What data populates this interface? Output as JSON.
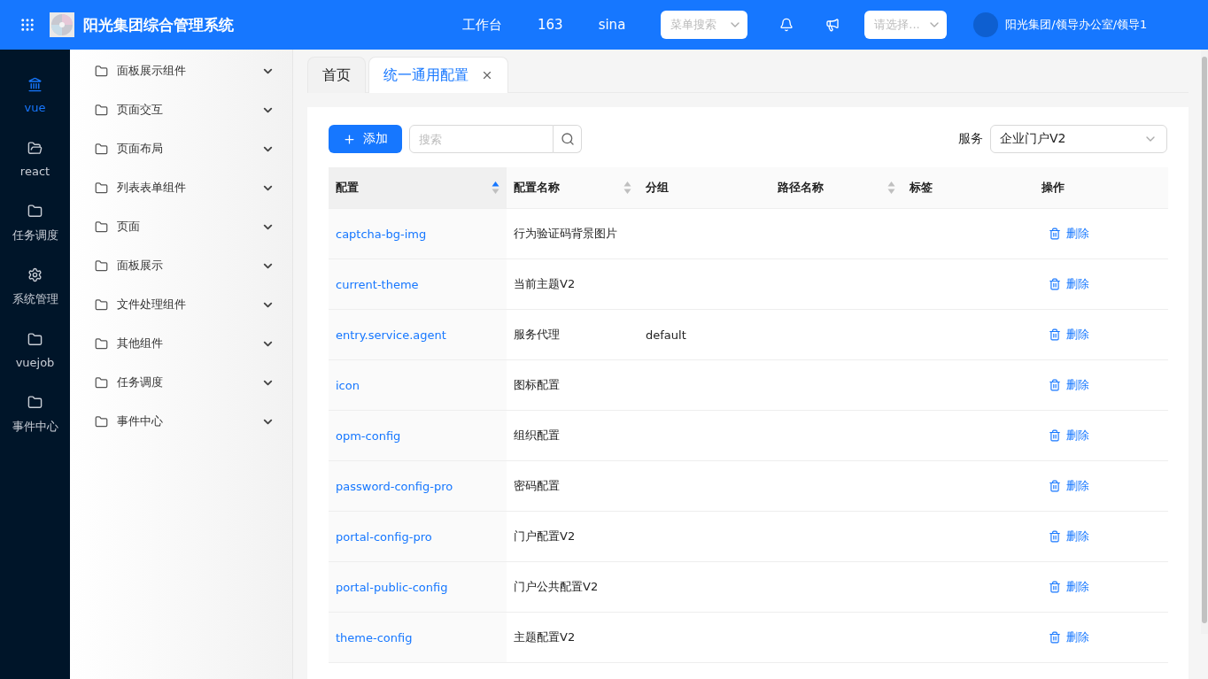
{
  "header": {
    "title": "阳光集团综合管理系统",
    "nav": [
      "工作台",
      "163",
      "sina"
    ],
    "menu_search": {
      "placeholder": "菜单搜索"
    },
    "org_select": {
      "placeholder": "请选择..."
    },
    "user": "阳光集团/领导办公室/领导1"
  },
  "rail": [
    {
      "label": "vue",
      "selected": true
    },
    {
      "label": "react",
      "selected": false
    },
    {
      "label": "任务调度",
      "selected": false
    },
    {
      "label": "系统管理",
      "selected": false
    },
    {
      "label": "vuejob",
      "selected": false
    },
    {
      "label": "事件中心",
      "selected": false
    }
  ],
  "submenu": [
    {
      "label": "面板展示组件",
      "expanded": false
    },
    {
      "label": "页面交互",
      "expanded": false
    },
    {
      "label": "页面布局",
      "expanded": false
    },
    {
      "label": "列表表单组件",
      "expanded": false
    },
    {
      "label": "页面",
      "expanded": false
    },
    {
      "label": "面板展示",
      "expanded": false
    },
    {
      "label": "文件处理组件",
      "expanded": false
    },
    {
      "label": "其他组件",
      "expanded": false
    },
    {
      "label": "任务调度",
      "expanded": false
    },
    {
      "label": "事件中心",
      "expanded": false
    }
  ],
  "tabs": [
    {
      "label": "首页",
      "selected": false,
      "closable": false
    },
    {
      "label": "统一通用配置",
      "selected": true,
      "closable": true
    }
  ],
  "toolbar": {
    "add": "添加",
    "search": {
      "placeholder": "搜索"
    },
    "service_label": "服务",
    "service_value": "企业门户V2"
  },
  "table": {
    "columns": [
      {
        "label": "配置",
        "sortable": true,
        "sorted": true
      },
      {
        "label": "配置名称",
        "sortable": true,
        "sorted": false
      },
      {
        "label": "分组"
      },
      {
        "label": "路径名称",
        "sortable": true,
        "sorted": false
      },
      {
        "label": "标签"
      },
      {
        "label": "操作"
      }
    ],
    "rows": [
      {
        "key": "captcha-bg-img",
        "name": "行为验证码背景图片",
        "action": "删除"
      },
      {
        "key": "current-theme",
        "name": "当前主题V2",
        "action": "删除"
      },
      {
        "key": "entry.service.agent",
        "name": "服务代理",
        "group": "default",
        "action": "删除"
      },
      {
        "key": "icon",
        "name": "图标配置",
        "action": "删除"
      },
      {
        "key": "opm-config",
        "name": "组织配置",
        "action": "删除"
      },
      {
        "key": "password-config-pro",
        "name": "密码配置",
        "action": "删除"
      },
      {
        "key": "portal-config-pro",
        "name": "门户配置V2",
        "action": "删除"
      },
      {
        "key": "portal-public-config",
        "name": "门户公共配置V2",
        "action": "删除"
      },
      {
        "key": "theme-config",
        "name": "主题配置V2",
        "action": "删除"
      }
    ]
  }
}
